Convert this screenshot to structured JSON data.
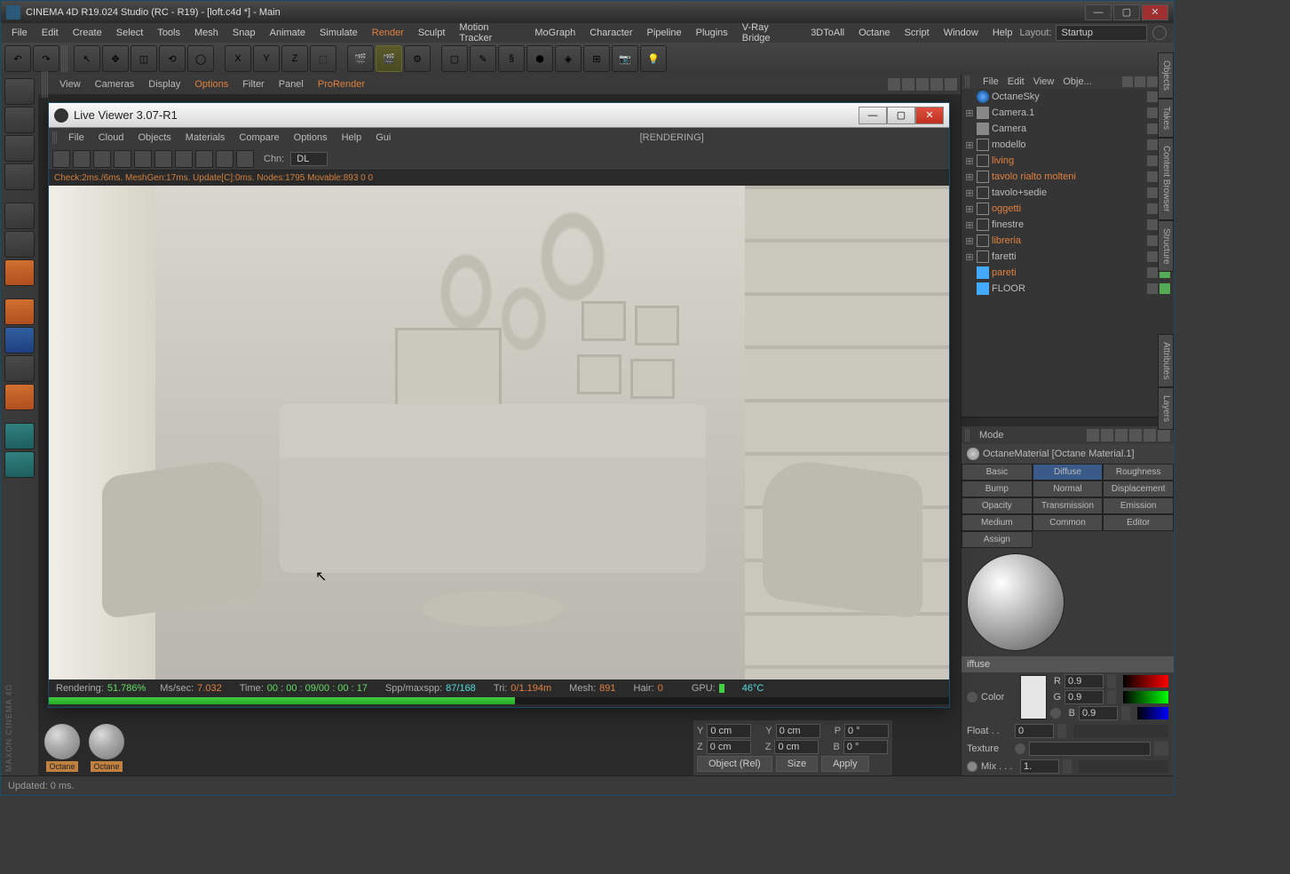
{
  "window": {
    "title": "CINEMA 4D R19.024 Studio (RC - R19) - [loft.c4d *] - Main"
  },
  "menubar": {
    "items": [
      "File",
      "Edit",
      "Create",
      "Select",
      "Tools",
      "Mesh",
      "Snap",
      "Animate",
      "Simulate",
      "Render",
      "Sculpt",
      "Motion Tracker",
      "MoGraph",
      "Character",
      "Pipeline",
      "Plugins",
      "V-Ray Bridge",
      "3DToAll",
      "Octane",
      "Script",
      "Window",
      "Help"
    ],
    "orange_idx": 9,
    "layout_label": "Layout:",
    "layout_value": "Startup"
  },
  "viewport_menubar": {
    "items": [
      "View",
      "Cameras",
      "Display",
      "Options",
      "Filter",
      "Panel",
      "ProRender"
    ],
    "orange": [
      3,
      6
    ]
  },
  "objects_panel": {
    "menus": [
      "File",
      "Edit",
      "View",
      "Obje..."
    ],
    "tree": [
      {
        "expand": "",
        "icon": "sky",
        "label": "OctaneSky",
        "orange": false
      },
      {
        "expand": "⊞",
        "icon": "cam",
        "label": "Camera.1",
        "orange": false,
        "red": true
      },
      {
        "expand": "",
        "icon": "cam",
        "label": "Camera",
        "orange": false
      },
      {
        "expand": "⊞",
        "icon": "null",
        "label": "modello",
        "orange": false
      },
      {
        "expand": "⊞",
        "icon": "null",
        "label": "living",
        "orange": true
      },
      {
        "expand": "⊞",
        "icon": "null",
        "label": "tavolo rialto molteni",
        "orange": true
      },
      {
        "expand": "⊞",
        "icon": "null",
        "label": "tavolo+sedie",
        "orange": false
      },
      {
        "expand": "⊞",
        "icon": "null",
        "label": "oggetti",
        "orange": true
      },
      {
        "expand": "⊞",
        "icon": "null",
        "label": "finestre",
        "orange": false
      },
      {
        "expand": "⊞",
        "icon": "null",
        "label": "libreria",
        "orange": true
      },
      {
        "expand": "⊞",
        "icon": "null",
        "label": "faretti",
        "orange": false
      },
      {
        "expand": "",
        "icon": "poly",
        "label": "pareti",
        "orange": true
      },
      {
        "expand": "",
        "icon": "poly",
        "label": "FLOOR",
        "orange": false
      }
    ]
  },
  "attributes": {
    "mode_label": "Mode",
    "title": "OctaneMaterial [Octane Material.1]",
    "tabs": [
      "Basic",
      "Diffuse",
      "Roughness",
      "Bump",
      "Normal",
      "Displacement",
      "Opacity",
      "Transmission",
      "Emission",
      "Medium",
      "Common",
      "Editor",
      "Assign"
    ],
    "active_tab": 1,
    "section": "iffuse",
    "color_label": "Color",
    "r_label": "R",
    "r_val": "0.9",
    "g_label": "G",
    "g_val": "0.9",
    "b_label": "B",
    "b_val": "0.9",
    "float_label": "Float . .",
    "float_val": "0",
    "texture_label": "Texture",
    "mix_label": "Mix . . .",
    "mix_val": "1."
  },
  "coords": {
    "rows": [
      {
        "axis": "Y",
        "v1": "0 cm",
        "v2": "0 cm",
        "p": "P",
        "pv": "0 °"
      },
      {
        "axis": "Z",
        "v1": "0 cm",
        "v2": "0 cm",
        "b": "B",
        "bv": "0 °"
      }
    ],
    "object_rel": "Object (Rel)",
    "size": "Size",
    "apply": "Apply"
  },
  "materials": {
    "thumbs": [
      "Octane",
      "Octane"
    ]
  },
  "status": {
    "text": "Updated: 0 ms."
  },
  "side_tabs": [
    "Objects",
    "Takes",
    "Content Browser",
    "Structure",
    "Attributes",
    "Layers"
  ],
  "live_viewer": {
    "title": "Live Viewer 3.07-R1",
    "menus": [
      "File",
      "Cloud",
      "Objects",
      "Materials",
      "Compare",
      "Options",
      "Help",
      "Gui"
    ],
    "render_status": "[RENDERING]",
    "chn_label": "Chn:",
    "chn_value": "DL",
    "stats": "Check:2ms./6ms. MeshGen:17ms. Update[C]:0ms. Nodes:1795 Movable:893  0 0",
    "bottom": {
      "rendering_label": "Rendering:",
      "rendering_val": "51.786%",
      "mssec_label": "Ms/sec:",
      "mssec_val": "7.032",
      "time_label": "Time:",
      "time_val": "00 : 00 : 09/00 : 00 : 17",
      "spp_label": "Spp/maxspp:",
      "spp_val": "87/168",
      "tri_label": "Tri:",
      "tri_val": "0/1.194m",
      "mesh_label": "Mesh:",
      "mesh_val": "891",
      "hair_label": "Hair:",
      "hair_val": "0",
      "gpu_label": "GPU:",
      "gpu_temp": "46°C"
    }
  }
}
